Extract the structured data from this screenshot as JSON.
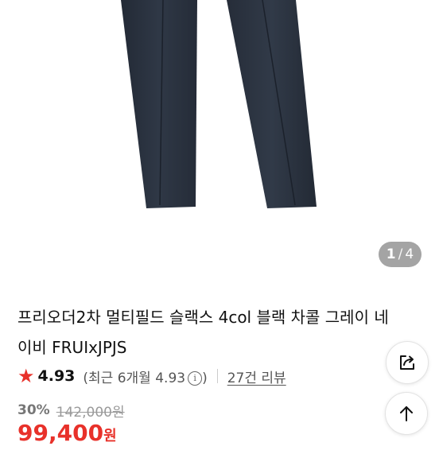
{
  "image": {
    "alt": "",
    "pager": {
      "current": "1",
      "separator": "/",
      "total": "4"
    }
  },
  "product": {
    "title": "프리오더2차 멀티필드 슬랙스 4col 블랙 차콜 그레이 네이비 FRUIxJPJS",
    "rating": {
      "score": "4.93",
      "recent_label": "(최근 6개월 4.93",
      "recent_close": ")"
    },
    "reviews_label": "27건 리뷰",
    "discount": "30%",
    "original_price": "142,000원",
    "sale_price": "99,400",
    "sale_unit": "원"
  },
  "colors": {
    "accent_red": "#e8312a",
    "trousers_navy": "#2b3341"
  },
  "icons": {
    "rating": "star-icon",
    "info": "info-icon",
    "share": "share-icon",
    "scroll_top": "arrow-up-icon"
  }
}
